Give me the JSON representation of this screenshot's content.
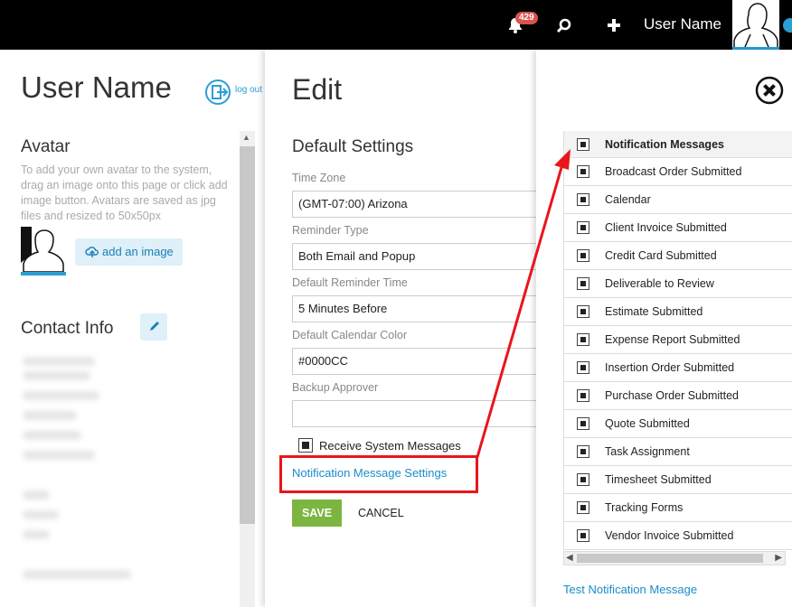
{
  "topbar": {
    "notification_count": "429",
    "user_name": "User Name",
    "icons": [
      "bell-icon",
      "search-icon",
      "plus-icon",
      "user-avatar"
    ]
  },
  "left_panel": {
    "title": "User Name",
    "logout": "log out",
    "avatar_heading": "Avatar",
    "avatar_help": "To add your own avatar to the system, drag an image onto this page or click add image button. Avatars are saved as jpg files and resized to 50x50px",
    "add_image": "add an image",
    "contact_heading": "Contact Info"
  },
  "edit_panel": {
    "title": "Edit",
    "section_heading": "Default Settings",
    "fields": [
      {
        "label": "Time Zone",
        "value": "(GMT-07:00) Arizona"
      },
      {
        "label": "Reminder Type",
        "value": "Both Email and Popup"
      },
      {
        "label": "Default Reminder Time",
        "value": "5 Minutes Before"
      },
      {
        "label": "Default Calendar Color",
        "value": "#0000CC"
      },
      {
        "label": "Backup Approver",
        "value": ""
      }
    ],
    "receive_system_messages": "Receive System Messages",
    "notification_settings_link": "Notification Message Settings",
    "save": "SAVE",
    "cancel": "CANCEL"
  },
  "notifications_panel": {
    "header": "Notification Messages",
    "items": [
      "Broadcast Order Submitted",
      "Calendar",
      "Client Invoice Submitted",
      "Credit Card Submitted",
      "Deliverable to Review",
      "Estimate Submitted",
      "Expense Report Submitted",
      "Insertion Order Submitted",
      "Purchase Order Submitted",
      "Quote Submitted",
      "Task Assignment",
      "Timesheet Submitted",
      "Tracking Forms",
      "Vendor Invoice Submitted"
    ],
    "test_link": "Test Notification Message"
  },
  "colors": {
    "accent": "#2a9fd6",
    "save_green": "#7cb640",
    "highlight_red": "#e8161b",
    "link_blue": "#1a8cc9"
  }
}
